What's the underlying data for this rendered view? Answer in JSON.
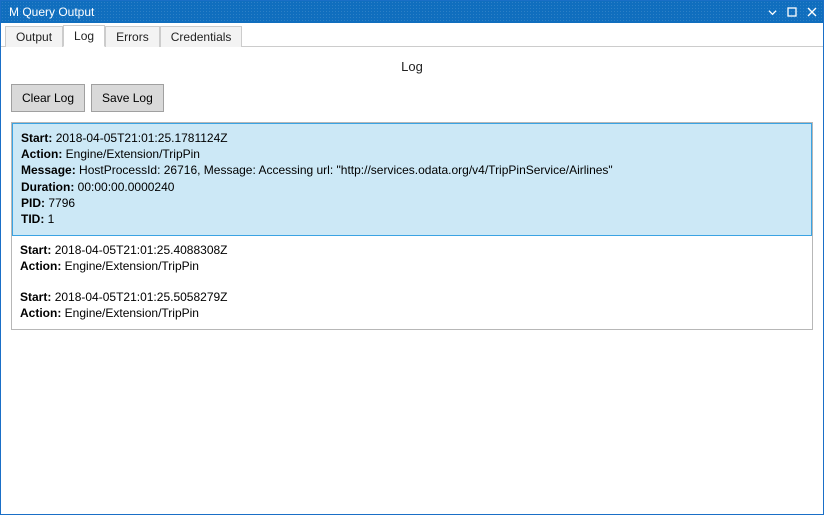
{
  "window": {
    "title": "M Query Output"
  },
  "tabs": [
    {
      "label": "Output",
      "active": false
    },
    {
      "label": "Log",
      "active": true
    },
    {
      "label": "Errors",
      "active": false
    },
    {
      "label": "Credentials",
      "active": false
    }
  ],
  "page": {
    "heading": "Log"
  },
  "toolbar": {
    "clear_label": "Clear Log",
    "save_label": "Save Log"
  },
  "labels": {
    "start": "Start:",
    "action": "Action:",
    "message": "Message:",
    "duration": "Duration:",
    "pid": "PID:",
    "tid": "TID:"
  },
  "log": {
    "entries": [
      {
        "selected": true,
        "start": "2018-04-05T21:01:25.1781124Z",
        "action": "Engine/Extension/TripPin",
        "message": "HostProcessId: 26716, Message: Accessing url: \"http://services.odata.org/v4/TripPinService/Airlines\"",
        "duration": "00:00:00.0000240",
        "pid": "7796",
        "tid": "1"
      },
      {
        "selected": false,
        "start": "2018-04-05T21:01:25.4088308Z",
        "action": "Engine/Extension/TripPin"
      },
      {
        "selected": false,
        "start": "2018-04-05T21:01:25.5058279Z",
        "action": "Engine/Extension/TripPin"
      }
    ]
  }
}
